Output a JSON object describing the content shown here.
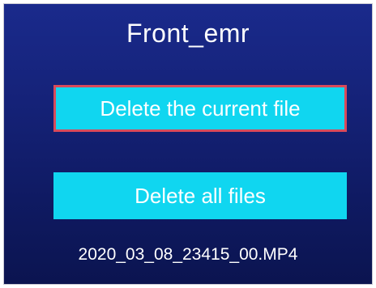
{
  "screen": {
    "title": "Front_emr",
    "buttons": {
      "delete_current": "Delete the current file",
      "delete_all": "Delete all files"
    },
    "filename": "2020_03_08_23415_00.MP4",
    "colors": {
      "background": "#152278",
      "button": "#10d6f0",
      "selection_border": "#d84a5a",
      "text": "#ffffff"
    }
  }
}
